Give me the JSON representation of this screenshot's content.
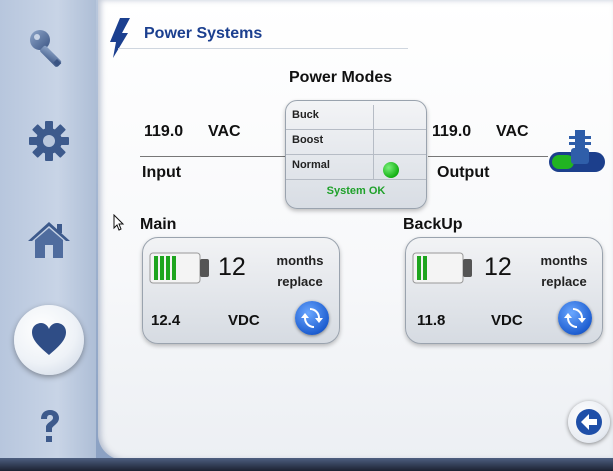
{
  "header": {
    "title": "Power Systems",
    "icon": "lightning-bolt-icon"
  },
  "sidebar": {
    "items": [
      {
        "name": "key",
        "icon": "key-icon"
      },
      {
        "name": "settings",
        "icon": "gear-icon"
      },
      {
        "name": "home",
        "icon": "home-icon"
      },
      {
        "name": "favorites",
        "icon": "heart-icon",
        "active": true
      },
      {
        "name": "help",
        "icon": "question-icon"
      }
    ]
  },
  "power": {
    "modes_title": "Power Modes",
    "input": {
      "value": "119.0",
      "unit": "VAC",
      "label": "Input"
    },
    "output": {
      "value": "119.0",
      "unit": "VAC",
      "label": "Output"
    },
    "modes": [
      {
        "label": "Buck",
        "active": false
      },
      {
        "label": "Boost",
        "active": false
      },
      {
        "label": "Normal",
        "active": true
      }
    ],
    "status": "System OK",
    "status_color": "#1fa12a"
  },
  "batteries": {
    "main": {
      "label": "Main",
      "months": "12",
      "months_label": "months",
      "replace_label": "replace",
      "voltage": "12.4",
      "voltage_unit": "VDC",
      "charge_bars": 4
    },
    "backup": {
      "label": "BackUp",
      "months": "12",
      "months_label": "months",
      "replace_label": "replace",
      "voltage": "11.8",
      "voltage_unit": "VDC",
      "charge_bars": 2
    }
  },
  "colors": {
    "accent": "#1b3f8f",
    "green": "#13b013",
    "blue": "#1f5fd1"
  }
}
